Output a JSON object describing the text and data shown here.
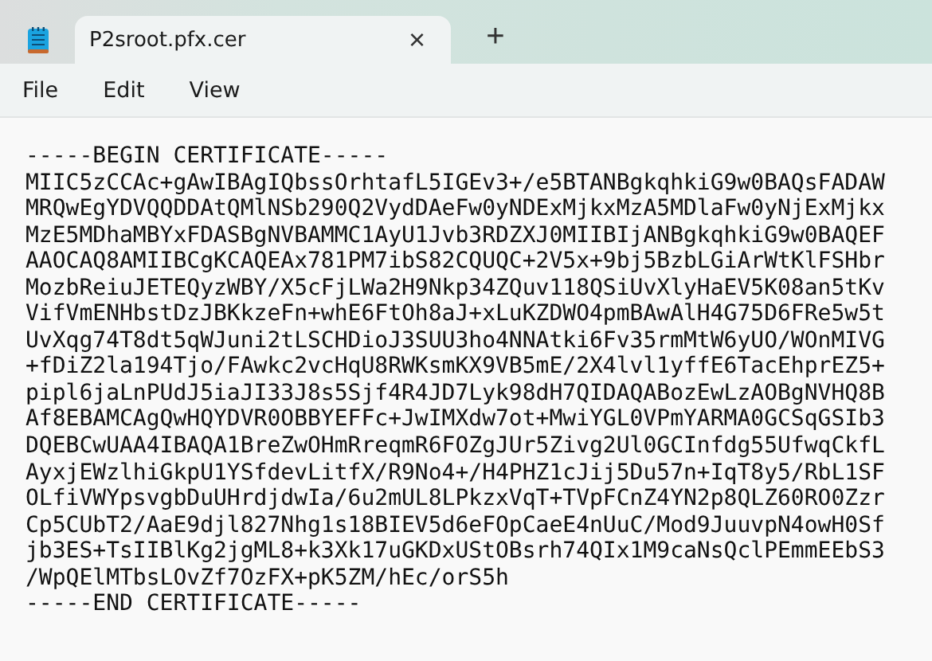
{
  "tabs": [
    {
      "label": "P2sroot.pfx.cer",
      "selected": true,
      "close": "×"
    }
  ],
  "new_tab": "+",
  "menu": [
    "File",
    "Edit",
    "View"
  ],
  "lines": [
    "-----BEGIN CERTIFICATE-----",
    "MIIC5zCCAc+gAwIBAgIQbssOrhtafL5IGEv3+/e5BTANBgkqhkiG9w0BAQsFADAW",
    "MRQwEgYDVQQDDAtQMlNSb290Q2VydDAeFw0yNDExMjkxMzA5MDlaFw0yNjExMjkx",
    "MzE5MDhaMBYxFDASBgNVBAMMC1AyU1Jvb3RDZXJ0MIIBIjANBgkqhkiG9w0BAQEF",
    "AAOCAQ8AMIIBCgKCAQEAx781PM7ibS82CQUQC+2V5x+9bj5BzbLGiArWtKlFSHbr",
    "MozbReiuJETEQyzWBY/X5cFjLWa2H9Nkp34ZQuv118QSiUvXlyHaEV5K08an5tKv",
    "VifVmENHbstDzJBKkzeFn+whE6FtOh8aJ+xLuKZDWO4pmBAwAlH4G75D6FRe5w5t",
    "UvXqg74T8dt5qWJuni2tLSCHDioJ3SUU3ho4NNAtki6Fv35rmMtW6yUO/WOnMIVG",
    "+fDiZ2la194Tjo/FAwkc2vcHqU8RWKsmKX9VB5mE/2X4lvl1yffE6TacEhprEZ5+",
    "pipl6jaLnPUdJ5iaJI33J8s5Sjf4R4JD7Lyk98dH7QIDAQABozEwLzAOBgNVHQ8B",
    "Af8EBAMCAgQwHQYDVR0OBBYEFFc+JwIMXdw7ot+MwiYGL0VPmYARMA0GCSqGSIb3",
    "DQEBCwUAA4IBAQA1BreZwOHmRreqmR6FOZgJUr5Zivg2Ul0GCInfdg55UfwqCkfL",
    "AyxjEWzlhiGkpU1YSfdevLitfX/R9No4+/H4PHZ1cJij5Du57n+IqT8y5/RbL1SF",
    "OLfiVWYpsvgbDuUHrdjdwIa/6u2mUL8LPkzxVqT+TVpFCnZ4YN2p8QLZ60RO0Zzr",
    "Cp5CUbT2/AaE9djl827Nhg1s18BIEV5d6eFOpCaeE4nUuC/Mod9JuuvpN4owH0Sf",
    "jb3ES+TsIIBlKg2jgML8+k3Xk17uGKDxUStOBsrh74QIx1M9caNsQclPEmmEEbS3",
    "/WpQElMTbsLOvZf7OzFX+pK5ZM/hEc/orS5h",
    "-----END CERTIFICATE-----"
  ]
}
